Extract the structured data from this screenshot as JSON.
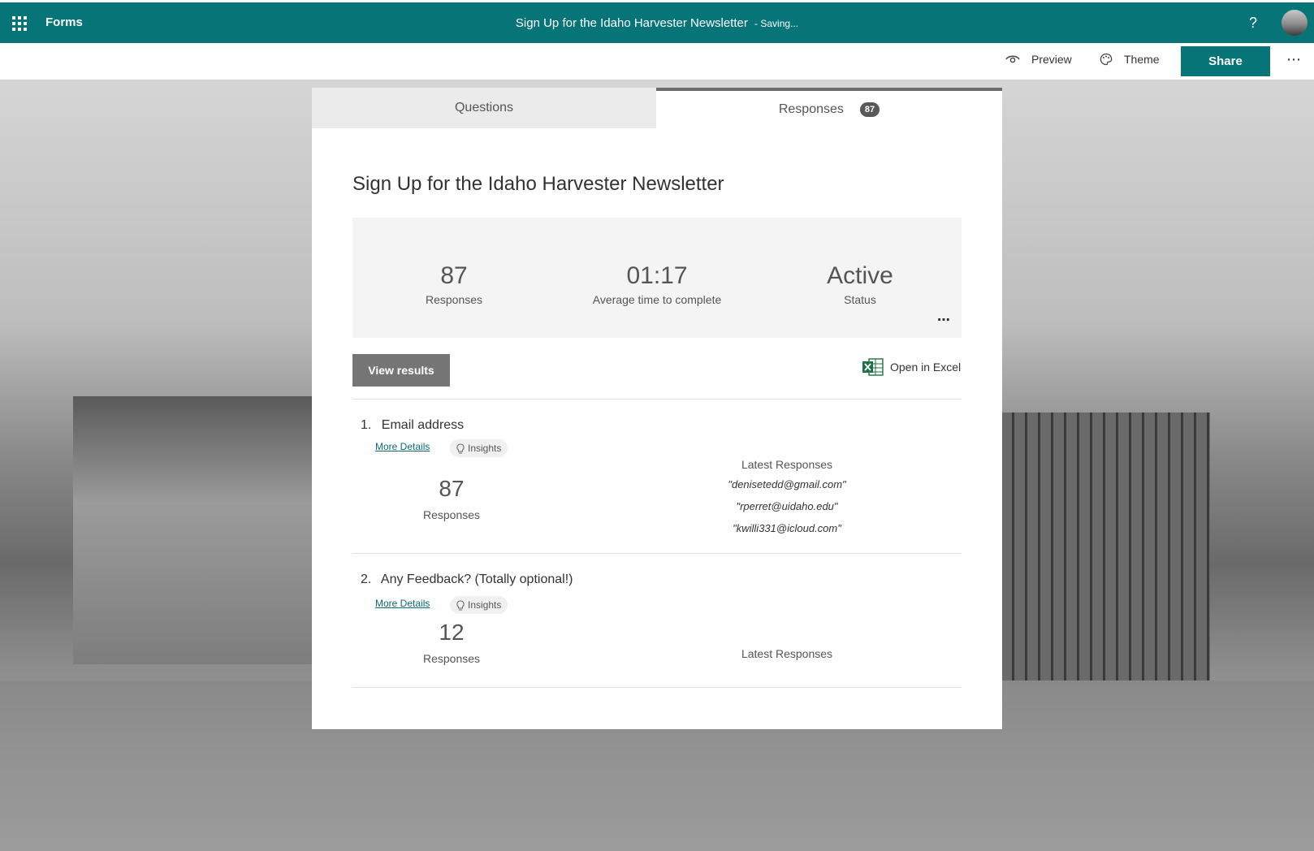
{
  "app": {
    "name": "Forms",
    "doc_title": "Sign Up for the Idaho Harvester Newsletter",
    "saving": "- Saving...",
    "help": "?"
  },
  "commandbar": {
    "preview": "Preview",
    "theme": "Theme",
    "share": "Share",
    "more": "⋯"
  },
  "tabs": {
    "questions": "Questions",
    "responses": "Responses",
    "responses_count": "87"
  },
  "form": {
    "title": "Sign Up for the Idaho Harvester Newsletter",
    "summary": {
      "responses_value": "87",
      "responses_label": "Responses",
      "avg_time_value": "01:17",
      "avg_time_label": "Average time to complete",
      "status_value": "Active",
      "status_label": "Status",
      "more": "⋯"
    },
    "view_results": "View results",
    "open_excel": "Open in Excel"
  },
  "questions": [
    {
      "number": "1.",
      "title": "Email address",
      "more_details": "More Details",
      "insights": "Insights",
      "count": "87",
      "count_label": "Responses",
      "latest_header": "Latest Responses",
      "latest": [
        "\"denisetedd@gmail.com\"",
        "\"rperret@uidaho.edu\"",
        "\"kwilli331@icloud.com\""
      ]
    },
    {
      "number": "2.",
      "title": "Any Feedback? (Totally optional!)",
      "more_details": "More Details",
      "insights": "Insights",
      "count": "12",
      "count_label": "Responses",
      "latest_header": "Latest Responses"
    }
  ],
  "colors": {
    "brand": "#077478",
    "button_gray": "#757575"
  }
}
